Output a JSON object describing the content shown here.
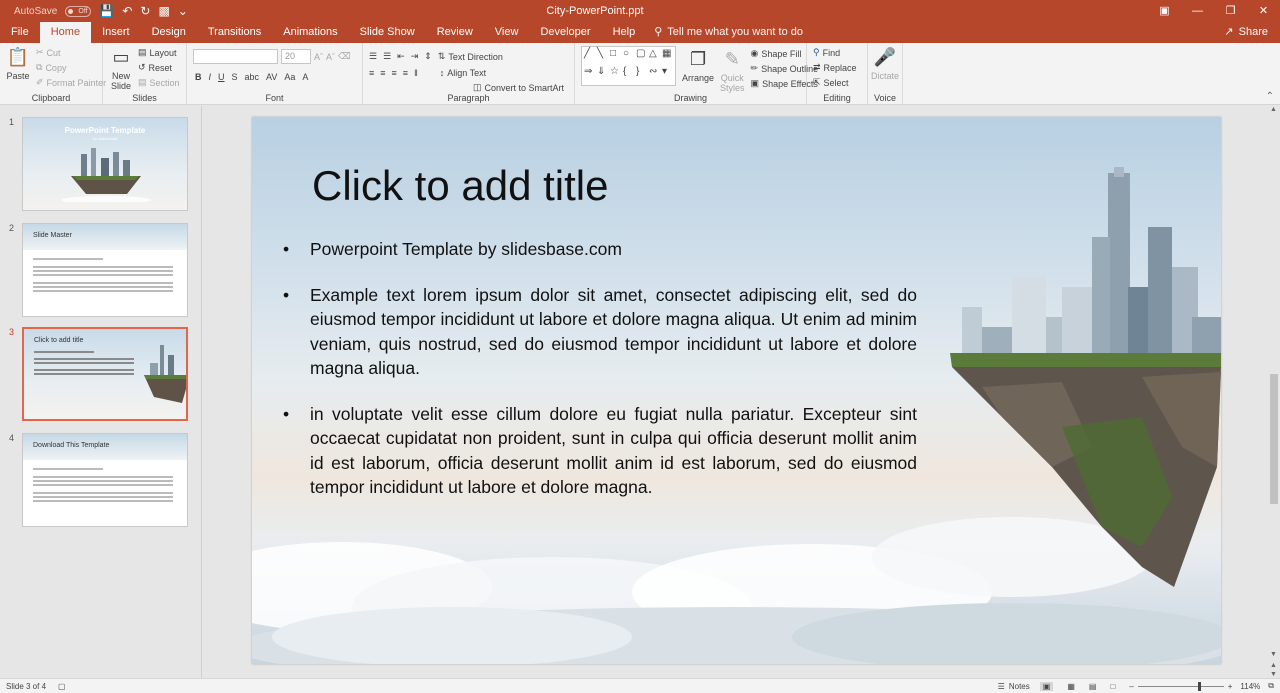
{
  "app": {
    "autosave_label": "AutoSave",
    "autosave_state": "Off",
    "doc_title": "City-PowerPoint.ppt"
  },
  "tabs": [
    "File",
    "Home",
    "Insert",
    "Design",
    "Transitions",
    "Animations",
    "Slide Show",
    "Review",
    "View",
    "Developer",
    "Help"
  ],
  "tellme": "Tell me what you want to do",
  "share": "Share",
  "ribbon": {
    "clipboard": {
      "paste": "Paste",
      "cut": "Cut",
      "copy": "Copy",
      "format_painter": "Format Painter",
      "label": "Clipboard"
    },
    "slides": {
      "new_slide_1": "New",
      "new_slide_2": "Slide",
      "layout": "Layout",
      "reset": "Reset",
      "section": "Section",
      "label": "Slides"
    },
    "font": {
      "size": "20",
      "label": "Font"
    },
    "paragraph": {
      "text_direction": "Text Direction",
      "align_text": "Align Text",
      "convert": "Convert to SmartArt",
      "label": "Paragraph"
    },
    "drawing": {
      "arrange": "Arrange",
      "quick_styles_1": "Quick",
      "quick_styles_2": "Styles",
      "shape_fill": "Shape Fill",
      "shape_outline": "Shape Outline",
      "shape_effects": "Shape Effects",
      "label": "Drawing"
    },
    "editing": {
      "find": "Find",
      "replace": "Replace",
      "select": "Select",
      "label": "Editing"
    },
    "voice": {
      "dictate": "Dictate",
      "label": "Voice"
    }
  },
  "thumbnails": [
    {
      "num": "1",
      "title": "PowerPoint Template",
      "subtitle": "by slidesbase"
    },
    {
      "num": "2",
      "title": "Slide Master"
    },
    {
      "num": "3",
      "title": "Click to add title"
    },
    {
      "num": "4",
      "title": "Download This Template"
    }
  ],
  "slide": {
    "title": "Click to add title",
    "bullets": [
      "Powerpoint Template by slidesbase.com",
      "Example text lorem ipsum dolor sit amet, consectet adipiscing elit, sed do eiusmod tempor incididunt ut labore et dolore magna aliqua. Ut enim ad minim veniam, quis nostrud, sed do eiusmod tempor incididunt ut labore et dolore magna aliqua.",
      "in voluptate velit esse cillum dolore eu fugiat nulla pariatur. Excepteur sint occaecat cupidatat non proident, sunt in culpa qui officia deserunt mollit anim id est laborum, officia deserunt mollit anim id est laborum, sed do eiusmod tempor incididunt ut labore et dolore magna."
    ]
  },
  "status": {
    "slide_info": "Slide 3 of 4",
    "notes": "Notes",
    "zoom": "114%"
  },
  "colors": {
    "accent": "#b7472a",
    "selected": "#e3654a"
  }
}
